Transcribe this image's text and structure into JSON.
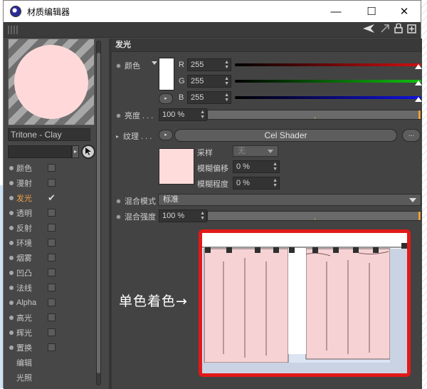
{
  "window": {
    "title": "材质编辑器",
    "minimize": "—",
    "maximize": "☐",
    "close": "✕"
  },
  "toolbar": {
    "icons": [
      "back-arrow-icon",
      "up-arrow-icon",
      "lock-icon",
      "new-window-icon"
    ]
  },
  "left": {
    "material_name": "Tritone - Clay",
    "picker_arrow": "▸",
    "channels": [
      {
        "label": "颜色",
        "checked": false,
        "active": false
      },
      {
        "label": "漫射",
        "checked": false,
        "active": false
      },
      {
        "label": "发光",
        "checked": true,
        "active": true
      },
      {
        "label": "透明",
        "checked": false,
        "active": false
      },
      {
        "label": "反射",
        "checked": false,
        "active": false
      },
      {
        "label": "环境",
        "checked": false,
        "active": false
      },
      {
        "label": "烟雾",
        "checked": false,
        "active": false
      },
      {
        "label": "凹凸",
        "checked": false,
        "active": false
      },
      {
        "label": "法线",
        "checked": false,
        "active": false
      },
      {
        "label": "Alpha",
        "checked": false,
        "active": false
      },
      {
        "label": "高光",
        "checked": false,
        "active": false
      },
      {
        "label": "辉光",
        "checked": false,
        "active": false
      },
      {
        "label": "置换",
        "checked": false,
        "active": false
      },
      {
        "label": "编辑",
        "checked": null,
        "active": false
      },
      {
        "label": "光照",
        "checked": null,
        "active": false
      }
    ],
    "check_mark": "✔"
  },
  "panel": {
    "section_title": "发光",
    "color_label": "颜色",
    "r_label": "R",
    "g_label": "G",
    "b_label": "B",
    "r_value": "255",
    "g_value": "255",
    "b_value": "255",
    "brightness_label": "亮度 . . .",
    "brightness_value": "100 %",
    "brightness_level": 1.0,
    "texture_label": "纹理 . . .",
    "texture_button": "Cel Shader",
    "more_button": "...",
    "sampling_label": "采样",
    "sampling_value": "无",
    "blur_offset_label": "模糊偏移",
    "blur_offset_value": "0 %",
    "blur_scale_label": "模糊程度",
    "blur_scale_value": "0 %",
    "blend_mode_label": "混合模式",
    "blend_mode_value": "标准",
    "blend_strength_label": "混合强度",
    "blend_strength_value": "100 %",
    "blend_strength_level": 1.0,
    "play_icon": "▸",
    "spin_up": "▲",
    "spin_down": "▼"
  },
  "annotation": {
    "text": "单色着色→"
  },
  "colors": {
    "accent": "#f0a24b",
    "emission_color": "#ffdcdc",
    "highlight_red": "#e21919"
  }
}
